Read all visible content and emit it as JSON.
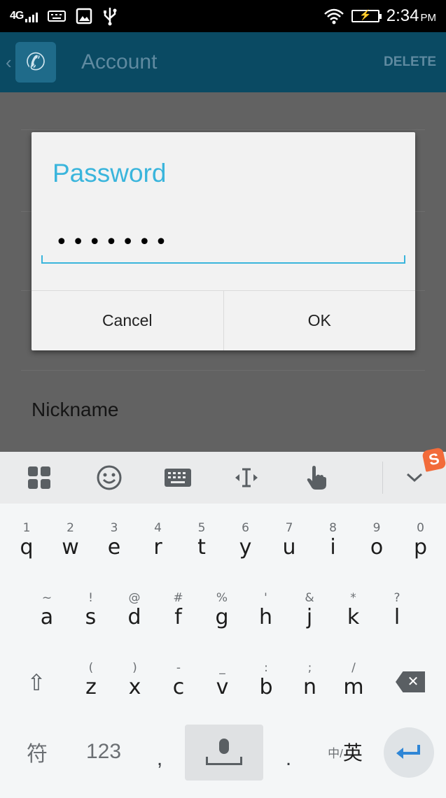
{
  "status_bar": {
    "network": "4G",
    "time": "2:34",
    "ampm": "PM",
    "icons": [
      "signal-icon",
      "keyboard-notify-icon",
      "image-icon",
      "usb-icon",
      "wifi-icon",
      "battery-charging-icon"
    ]
  },
  "app_bar": {
    "title": "Account",
    "delete_label": "DELETE",
    "back_glyph": "‹",
    "app_icon": "phone-transfer-icon"
  },
  "content": {
    "nickname_label": "Nickname"
  },
  "dialog": {
    "title": "Password",
    "password_value": "•••••••",
    "cancel_label": "Cancel",
    "ok_label": "OK"
  },
  "keyboard": {
    "toolbar": [
      "apps-grid-icon",
      "emoji-icon",
      "keyboard-icon",
      "cursor-icon",
      "hand-pointer-icon",
      "collapse-icon"
    ],
    "logo": "S",
    "rows": [
      [
        {
          "sub": "1",
          "main": "q"
        },
        {
          "sub": "2",
          "main": "w"
        },
        {
          "sub": "3",
          "main": "e"
        },
        {
          "sub": "4",
          "main": "r"
        },
        {
          "sub": "5",
          "main": "t"
        },
        {
          "sub": "6",
          "main": "y"
        },
        {
          "sub": "7",
          "main": "u"
        },
        {
          "sub": "8",
          "main": "i"
        },
        {
          "sub": "9",
          "main": "o"
        },
        {
          "sub": "0",
          "main": "p"
        }
      ],
      [
        {
          "sub": "~",
          "main": "a"
        },
        {
          "sub": "!",
          "main": "s"
        },
        {
          "sub": "@",
          "main": "d"
        },
        {
          "sub": "#",
          "main": "f"
        },
        {
          "sub": "%",
          "main": "g"
        },
        {
          "sub": "'",
          "main": "h"
        },
        {
          "sub": "&",
          "main": "j"
        },
        {
          "sub": "*",
          "main": "k"
        },
        {
          "sub": "?",
          "main": "l"
        }
      ],
      [
        {
          "sub": "(",
          "main": "z"
        },
        {
          "sub": ")",
          "main": "x"
        },
        {
          "sub": "-",
          "main": "c"
        },
        {
          "sub": "_",
          "main": "v"
        },
        {
          "sub": ":",
          "main": "b"
        },
        {
          "sub": ";",
          "main": "n"
        },
        {
          "sub": "/",
          "main": "m"
        }
      ]
    ],
    "bottom": {
      "symbols_label": "符",
      "numbers_label": "123",
      "comma_label": ",",
      "period_label": ".",
      "lang_small": "中/",
      "lang_big": "英"
    }
  },
  "colors": {
    "accent": "#3ab5dc",
    "app_bar": "#0a4a63",
    "overlay": "#626262",
    "enter": "#2f86d6",
    "logo": "#f26b3a"
  }
}
